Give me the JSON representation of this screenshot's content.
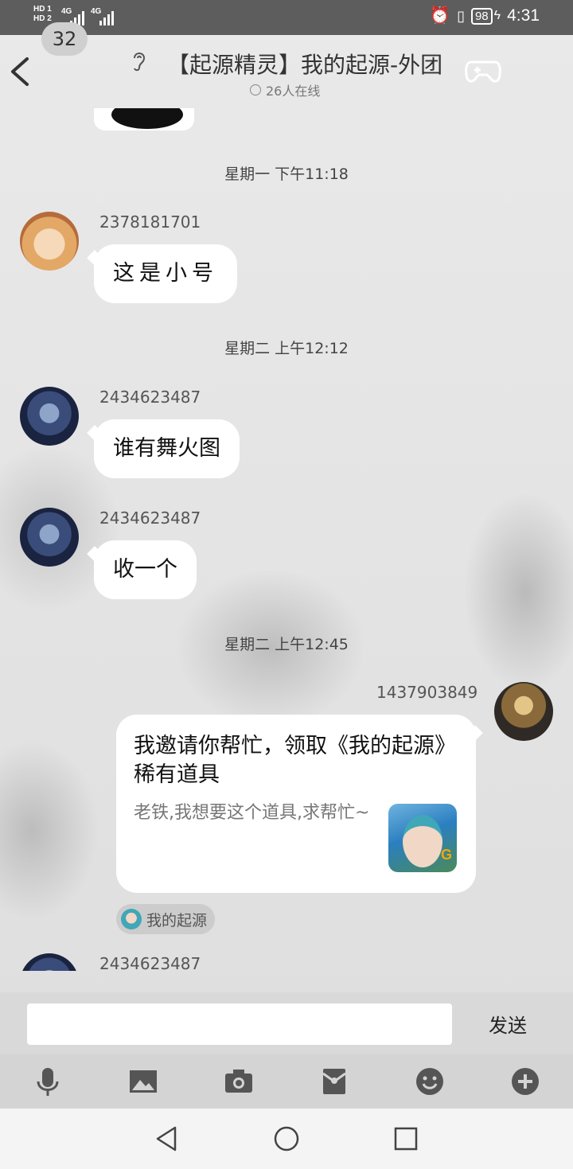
{
  "status_bar": {
    "sim1": "HD 1",
    "sim2": "HD 2",
    "network1": "4G",
    "network2": "4G",
    "battery": "98",
    "time": "4:31"
  },
  "header": {
    "unread_count": "32",
    "title": "【起源精灵】我的起源-外团",
    "online": "26人在线"
  },
  "messages": [
    {
      "type": "timestamp",
      "text": "星期一 下午11:18"
    },
    {
      "type": "text",
      "sender": "2378181701",
      "text": "这是小号",
      "side": "left"
    },
    {
      "type": "timestamp",
      "text": "星期二 上午12:12"
    },
    {
      "type": "text",
      "sender": "2434623487",
      "text": "谁有舞火图",
      "side": "left"
    },
    {
      "type": "text",
      "sender": "2434623487",
      "text": "收一个",
      "side": "left"
    },
    {
      "type": "timestamp",
      "text": "星期二 上午12:45"
    },
    {
      "type": "card",
      "sender": "1437903849",
      "side": "right",
      "title": "我邀请你帮忙，领取《我的起源》稀有道具",
      "desc": "老铁,我想要这个道具,求帮忙~",
      "source": "我的起源"
    },
    {
      "type": "text",
      "sender": "2434623487",
      "side": "left"
    }
  ],
  "input": {
    "value": "",
    "send_label": "发送"
  },
  "toolbar": [
    "mic-icon",
    "image-icon",
    "camera-icon",
    "red-packet-icon",
    "emoji-icon",
    "plus-icon"
  ]
}
